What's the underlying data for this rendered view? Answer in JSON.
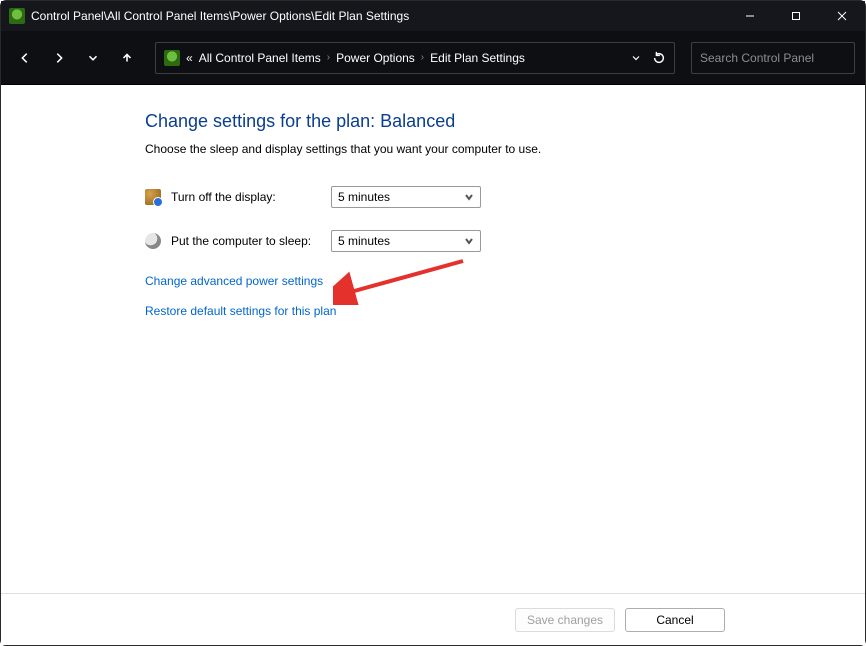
{
  "titlebar": {
    "path": "Control Panel\\All Control Panel Items\\Power Options\\Edit Plan Settings"
  },
  "breadcrumb": {
    "prefix": "«",
    "items": [
      "All Control Panel Items",
      "Power Options",
      "Edit Plan Settings"
    ]
  },
  "search": {
    "placeholder": "Search Control Panel"
  },
  "page": {
    "heading": "Change settings for the plan: Balanced",
    "sub": "Choose the sleep and display settings that you want your computer to use."
  },
  "rows": {
    "display": {
      "label": "Turn off the display:",
      "value": "5 minutes"
    },
    "sleep": {
      "label": "Put the computer to sleep:",
      "value": "5 minutes"
    }
  },
  "links": {
    "advanced": "Change advanced power settings",
    "restore": "Restore default settings for this plan"
  },
  "buttons": {
    "save": "Save changes",
    "cancel": "Cancel"
  }
}
